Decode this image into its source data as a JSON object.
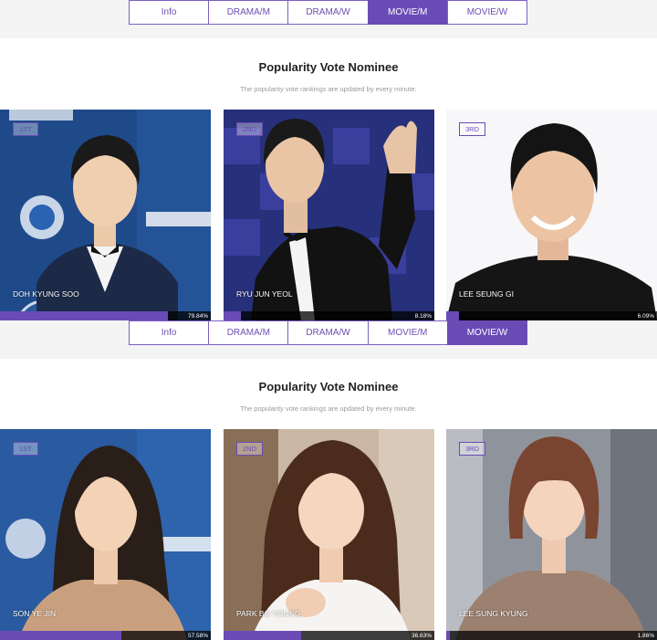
{
  "tabs_top": {
    "items": [
      {
        "label": "Info"
      },
      {
        "label": "DRAMA/M"
      },
      {
        "label": "DRAMA/W"
      },
      {
        "label": "MOVIE/M"
      },
      {
        "label": "MOVIE/W"
      }
    ],
    "active": "MOVIE/M"
  },
  "tabs_bottom": {
    "items": [
      {
        "label": "Info"
      },
      {
        "label": "DRAMA/M"
      },
      {
        "label": "DRAMA/W"
      },
      {
        "label": "MOVIE/M"
      },
      {
        "label": "MOVIE/W"
      }
    ],
    "active": "MOVIE/W"
  },
  "section1": {
    "title": "Popularity Vote Nominee",
    "subtitle": "The popularity vote rankings are updated by every minute.",
    "cards": [
      {
        "rank": "1ST",
        "name": "DOH KYUNG SOO",
        "percent": "79.84%",
        "fill": 0.7984
      },
      {
        "rank": "2ND",
        "name": "RYU JUN YEOL",
        "percent": "8.18%",
        "fill": 0.0818
      },
      {
        "rank": "3RD",
        "name": "LEE SEUNG GI",
        "percent": "6.09%",
        "fill": 0.0609
      }
    ]
  },
  "section2": {
    "title": "Popularity Vote Nominee",
    "subtitle": "The popularity vote rankings are updated by every minute.",
    "cards": [
      {
        "rank": "1ST",
        "name": "SON YE JIN",
        "percent": "57.58%",
        "fill": 0.5758
      },
      {
        "rank": "2ND",
        "name": "PARK BO YOUNG",
        "percent": "36.63%",
        "fill": 0.3663
      },
      {
        "rank": "3RD",
        "name": "LEE SUNG KYUNG",
        "percent": "1.86%",
        "fill": 0.0186
      }
    ]
  },
  "colors": {
    "accent": "#6a4bb6",
    "band": "#f4f4f4"
  }
}
